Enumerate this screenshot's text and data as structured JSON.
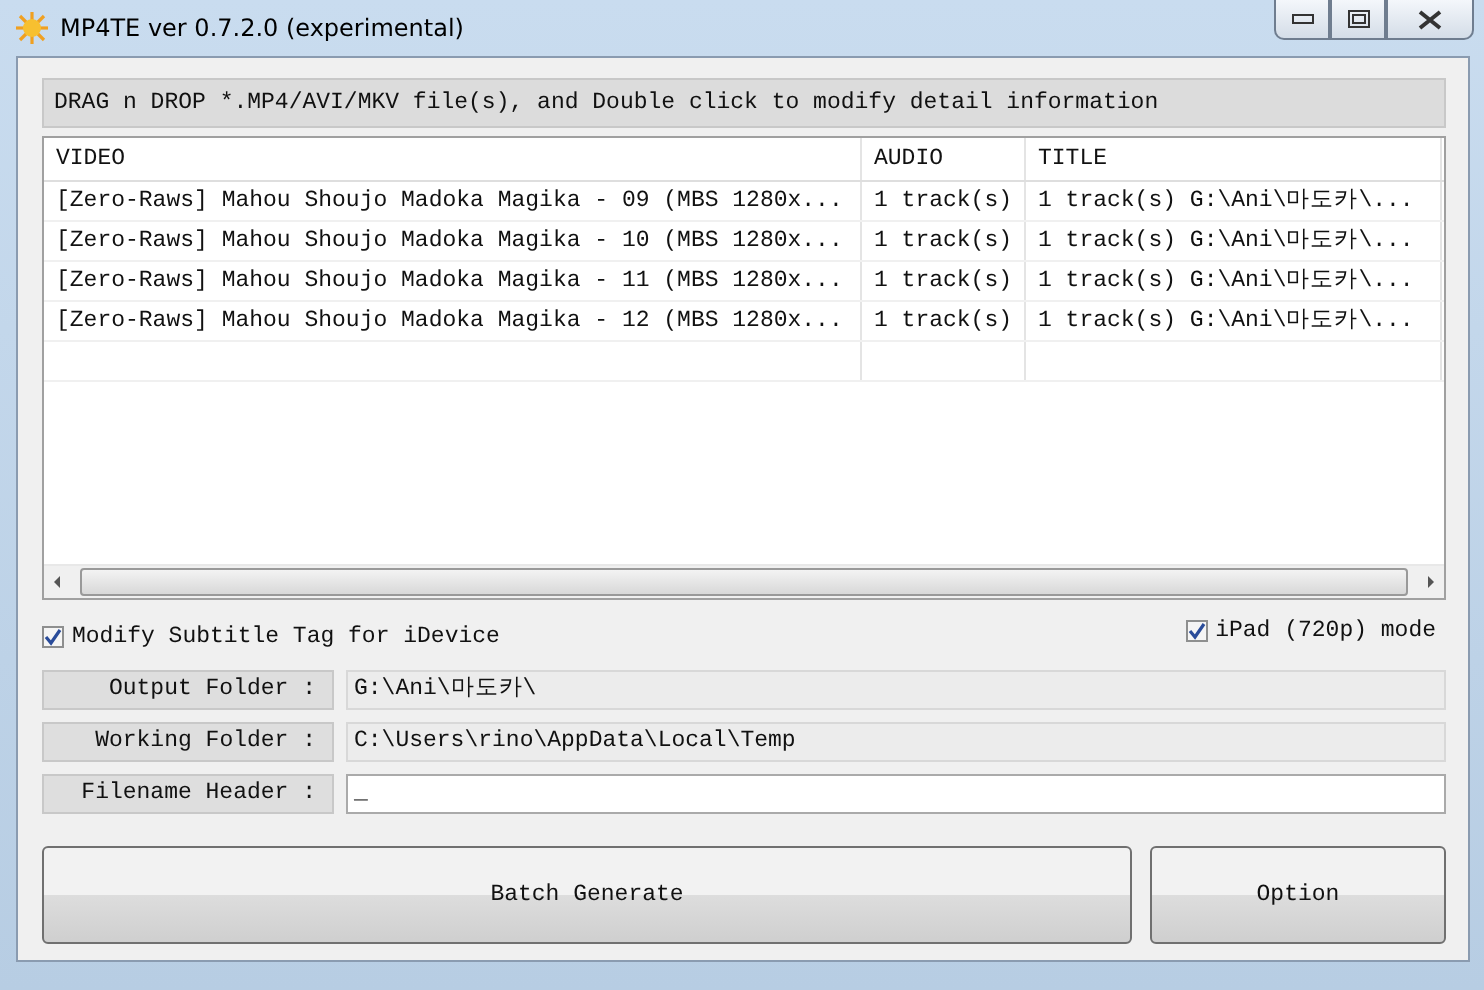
{
  "window": {
    "title": "MP4TE  ver 0.7.2.0 (experimental)"
  },
  "hint": "DRAG n DROP *.MP4/AVI/MKV file(s), and Double click to modify detail information",
  "table": {
    "columns": [
      "VIDEO",
      "AUDIO",
      "TITLE"
    ],
    "rows": [
      [
        "[Zero-Raws] Mahou Shoujo Madoka Magika - 09 (MBS 1280x...",
        "1 track(s)",
        "1 track(s) G:\\Ani\\마도카\\..."
      ],
      [
        "[Zero-Raws] Mahou Shoujo Madoka Magika - 10 (MBS 1280x...",
        "1 track(s)",
        "1 track(s) G:\\Ani\\마도카\\..."
      ],
      [
        "[Zero-Raws] Mahou Shoujo Madoka Magika - 11 (MBS 1280x...",
        "1 track(s)",
        "1 track(s) G:\\Ani\\마도카\\..."
      ],
      [
        "[Zero-Raws] Mahou Shoujo Madoka Magika - 12 (MBS 1280x...",
        "1 track(s)",
        "1 track(s) G:\\Ani\\마도카\\..."
      ]
    ]
  },
  "options": [
    {
      "label": "Modify Subtitle Tag for iDevice",
      "checked": true
    },
    {
      "label": "iPad (720p) mode",
      "checked": true
    }
  ],
  "fields": [
    {
      "label": "Output Folder :",
      "value": "G:\\Ani\\마도카\\",
      "editable": false
    },
    {
      "label": "Working Folder :",
      "value": "C:\\Users\\rino\\AppData\\Local\\Temp",
      "editable": false
    },
    {
      "label": "Filename Header :",
      "value": "_",
      "editable": true
    }
  ],
  "buttons": [
    "Batch Generate",
    "Option"
  ]
}
